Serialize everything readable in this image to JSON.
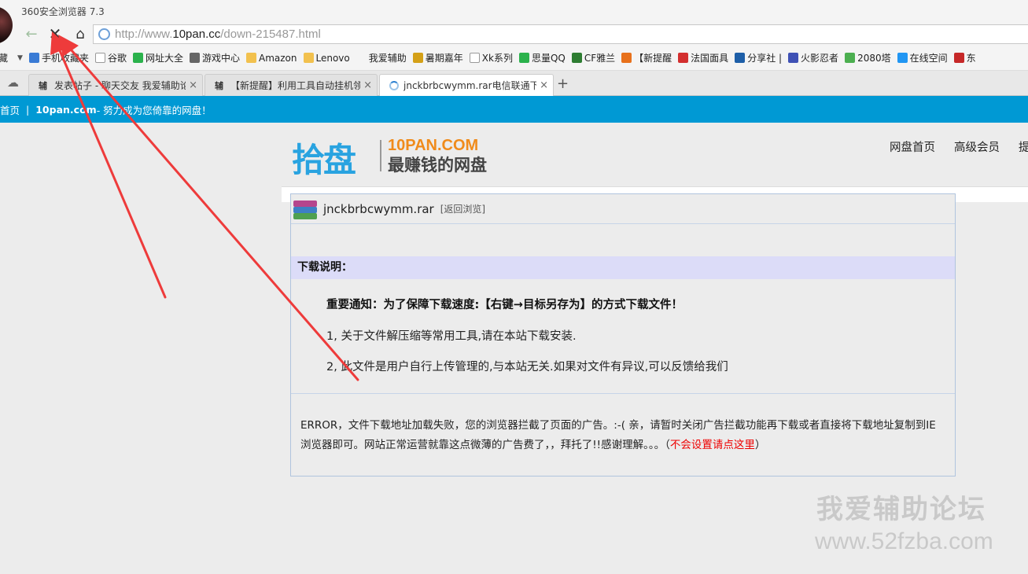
{
  "browser": {
    "title": "360安全浏览器 7.3",
    "url_prefix": "http://www.",
    "url_domain": "10pan.cc",
    "url_path": "/down-215487.html"
  },
  "bookmarks": [
    {
      "label": "藏",
      "color": "transparent"
    },
    {
      "label": "手机收藏夹",
      "color": "#3a7bd5"
    },
    {
      "label": "谷歌",
      "color": "#ffffff"
    },
    {
      "label": "网址大全",
      "color": "#2bb24c"
    },
    {
      "label": "游戏中心",
      "color": "#666666"
    },
    {
      "label": "Amazon",
      "color": "#f2c14e"
    },
    {
      "label": "Lenovo",
      "color": "#f2c14e"
    },
    {
      "label": "我爱辅助",
      "color": "transparent"
    },
    {
      "label": "暑期嘉年",
      "color": "#d4a017"
    },
    {
      "label": "Xk系列",
      "color": "#ffffff"
    },
    {
      "label": "思量QQ",
      "color": "#2bb24c"
    },
    {
      "label": "CF雅兰",
      "color": "#2e7d32"
    },
    {
      "label": "【新提醒",
      "color": "#e8711c"
    },
    {
      "label": "法国面具",
      "color": "#d32f2f"
    },
    {
      "label": "分享社 |",
      "color": "#1e5fa8"
    },
    {
      "label": "火影忍者",
      "color": "#3f51b5"
    },
    {
      "label": "2080塔",
      "color": "#4caf50"
    },
    {
      "label": "在线空间",
      "color": "#2196f3"
    },
    {
      "label": "东",
      "color": "#c62828"
    }
  ],
  "tabs": [
    {
      "icon": "辅",
      "label": "发表帖子 - 聊天交友 我爱辅助论坛",
      "close": "×"
    },
    {
      "icon": "辅",
      "label": "【新提醒】利用工具自动挂机领取",
      "close": "×"
    },
    {
      "icon": "",
      "label": "jnckbrbcwymm.rar电信联通下载",
      "close": "×"
    }
  ],
  "new_tab": "+",
  "strip": {
    "home": "首页",
    "sep": "|",
    "site": "10pan.com",
    "slogan": " - 努力成为您倚靠的网盘！"
  },
  "logo": {
    "cn": "拾盘",
    "en": "10PAN.COM",
    "sub": "最赚钱的网盘"
  },
  "site_nav": [
    "网盘首页",
    "高级会员",
    "提"
  ],
  "file": {
    "name": "jnckbrbcwymm.rar",
    "back": "[返回浏览]"
  },
  "notice": {
    "title": "下载说明：",
    "main": "重要通知：为了保障下载速度:【右键→目标另存为】的方式下载文件！",
    "item1": "1, 关于文件解压缩等常用工具,请在本站下载安装.",
    "item2": "2, 此文件是用户自行上传管理的,与本站无关.如果对文件有异议,可以反馈给我们"
  },
  "error": {
    "text": "ERROR，文件下载地址加载失败，您的浏览器拦截了页面的广告。:-( 亲，请暂时关闭广告拦截功能再下载或者直接将下载地址复制到IE浏览器即可。网站正常运营就靠这点微薄的广告费了，，拜托了!!感谢理解。。。（",
    "link": "不会设置请点这里",
    "tail": "）"
  },
  "watermark": {
    "cn": "我爱辅助论坛",
    "url": "www.52fzba.com"
  },
  "colors": {
    "strip_bg": "#0099d4",
    "notice_bg": "#dcdcf8",
    "arrow": "#ee3b3b",
    "error_link": "#ee0000"
  }
}
